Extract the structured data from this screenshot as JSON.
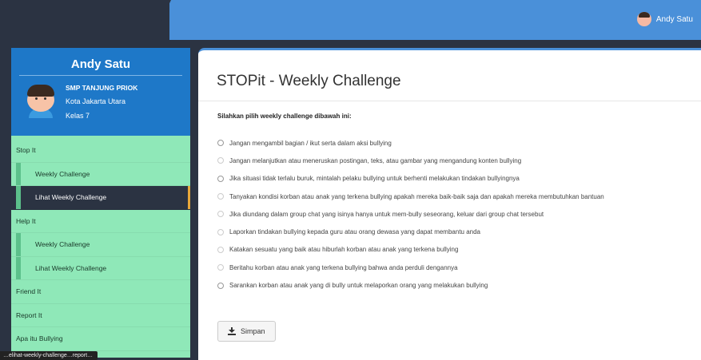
{
  "header": {
    "user_name": "Andy Satu"
  },
  "profile": {
    "name": "Andy Satu",
    "school": "SMP TANJUNG PRIOK",
    "city": "Kota Jakarta Utara",
    "kelas": "Kelas 7"
  },
  "sidebar": {
    "items": [
      {
        "label": "Stop It",
        "type": "top"
      },
      {
        "label": "Weekly Challenge",
        "type": "sub"
      },
      {
        "label": "Lihat Weekly Challenge",
        "type": "sub",
        "active": true
      },
      {
        "label": "Help It",
        "type": "top"
      },
      {
        "label": "Weekly Challenge",
        "type": "sub"
      },
      {
        "label": "Lihat Weekly Challenge",
        "type": "sub"
      },
      {
        "label": "Friend It",
        "type": "top"
      },
      {
        "label": "Report It",
        "type": "top"
      },
      {
        "label": "Apa itu Bullying",
        "type": "top"
      }
    ],
    "tooltip": "…elihat-weekly-challenge…report…"
  },
  "main": {
    "title": "STOPit - Weekly Challenge",
    "instruction": "Silahkan pilih weekly challenge dibawah ini:",
    "options": [
      "Jangan mengambil bagian / ikut serta dalam aksi bullying",
      "Jangan melanjutkan atau meneruskan postingan, teks, atau gambar yang mengandung konten bullying",
      "Jika situasi tidak terlalu buruk, mintalah pelaku bullying untuk berhenti melakukan tindakan bullyingnya",
      "Tanyakan kondisi korban atau anak yang terkena bullying apakah mereka baik-baik saja dan apakah mereka membutuhkan bantuan",
      "Jika diundang dalam group chat yang isinya hanya untuk mem-bully seseorang, keluar dari group chat tersebut",
      "Laporkan tindakan bullying kepada guru atau orang dewasa yang dapat membantu anda",
      "Katakan sesuatu yang baik atau hiburlah korban atau anak yang terkena bullying",
      "Beritahu korban atau anak yang terkena bullying bahwa anda perduli dengannya",
      "Sarankan korban atau anak yang di bully untuk melaporkan orang yang melakukan bullying"
    ],
    "save_label": "Simpan"
  }
}
